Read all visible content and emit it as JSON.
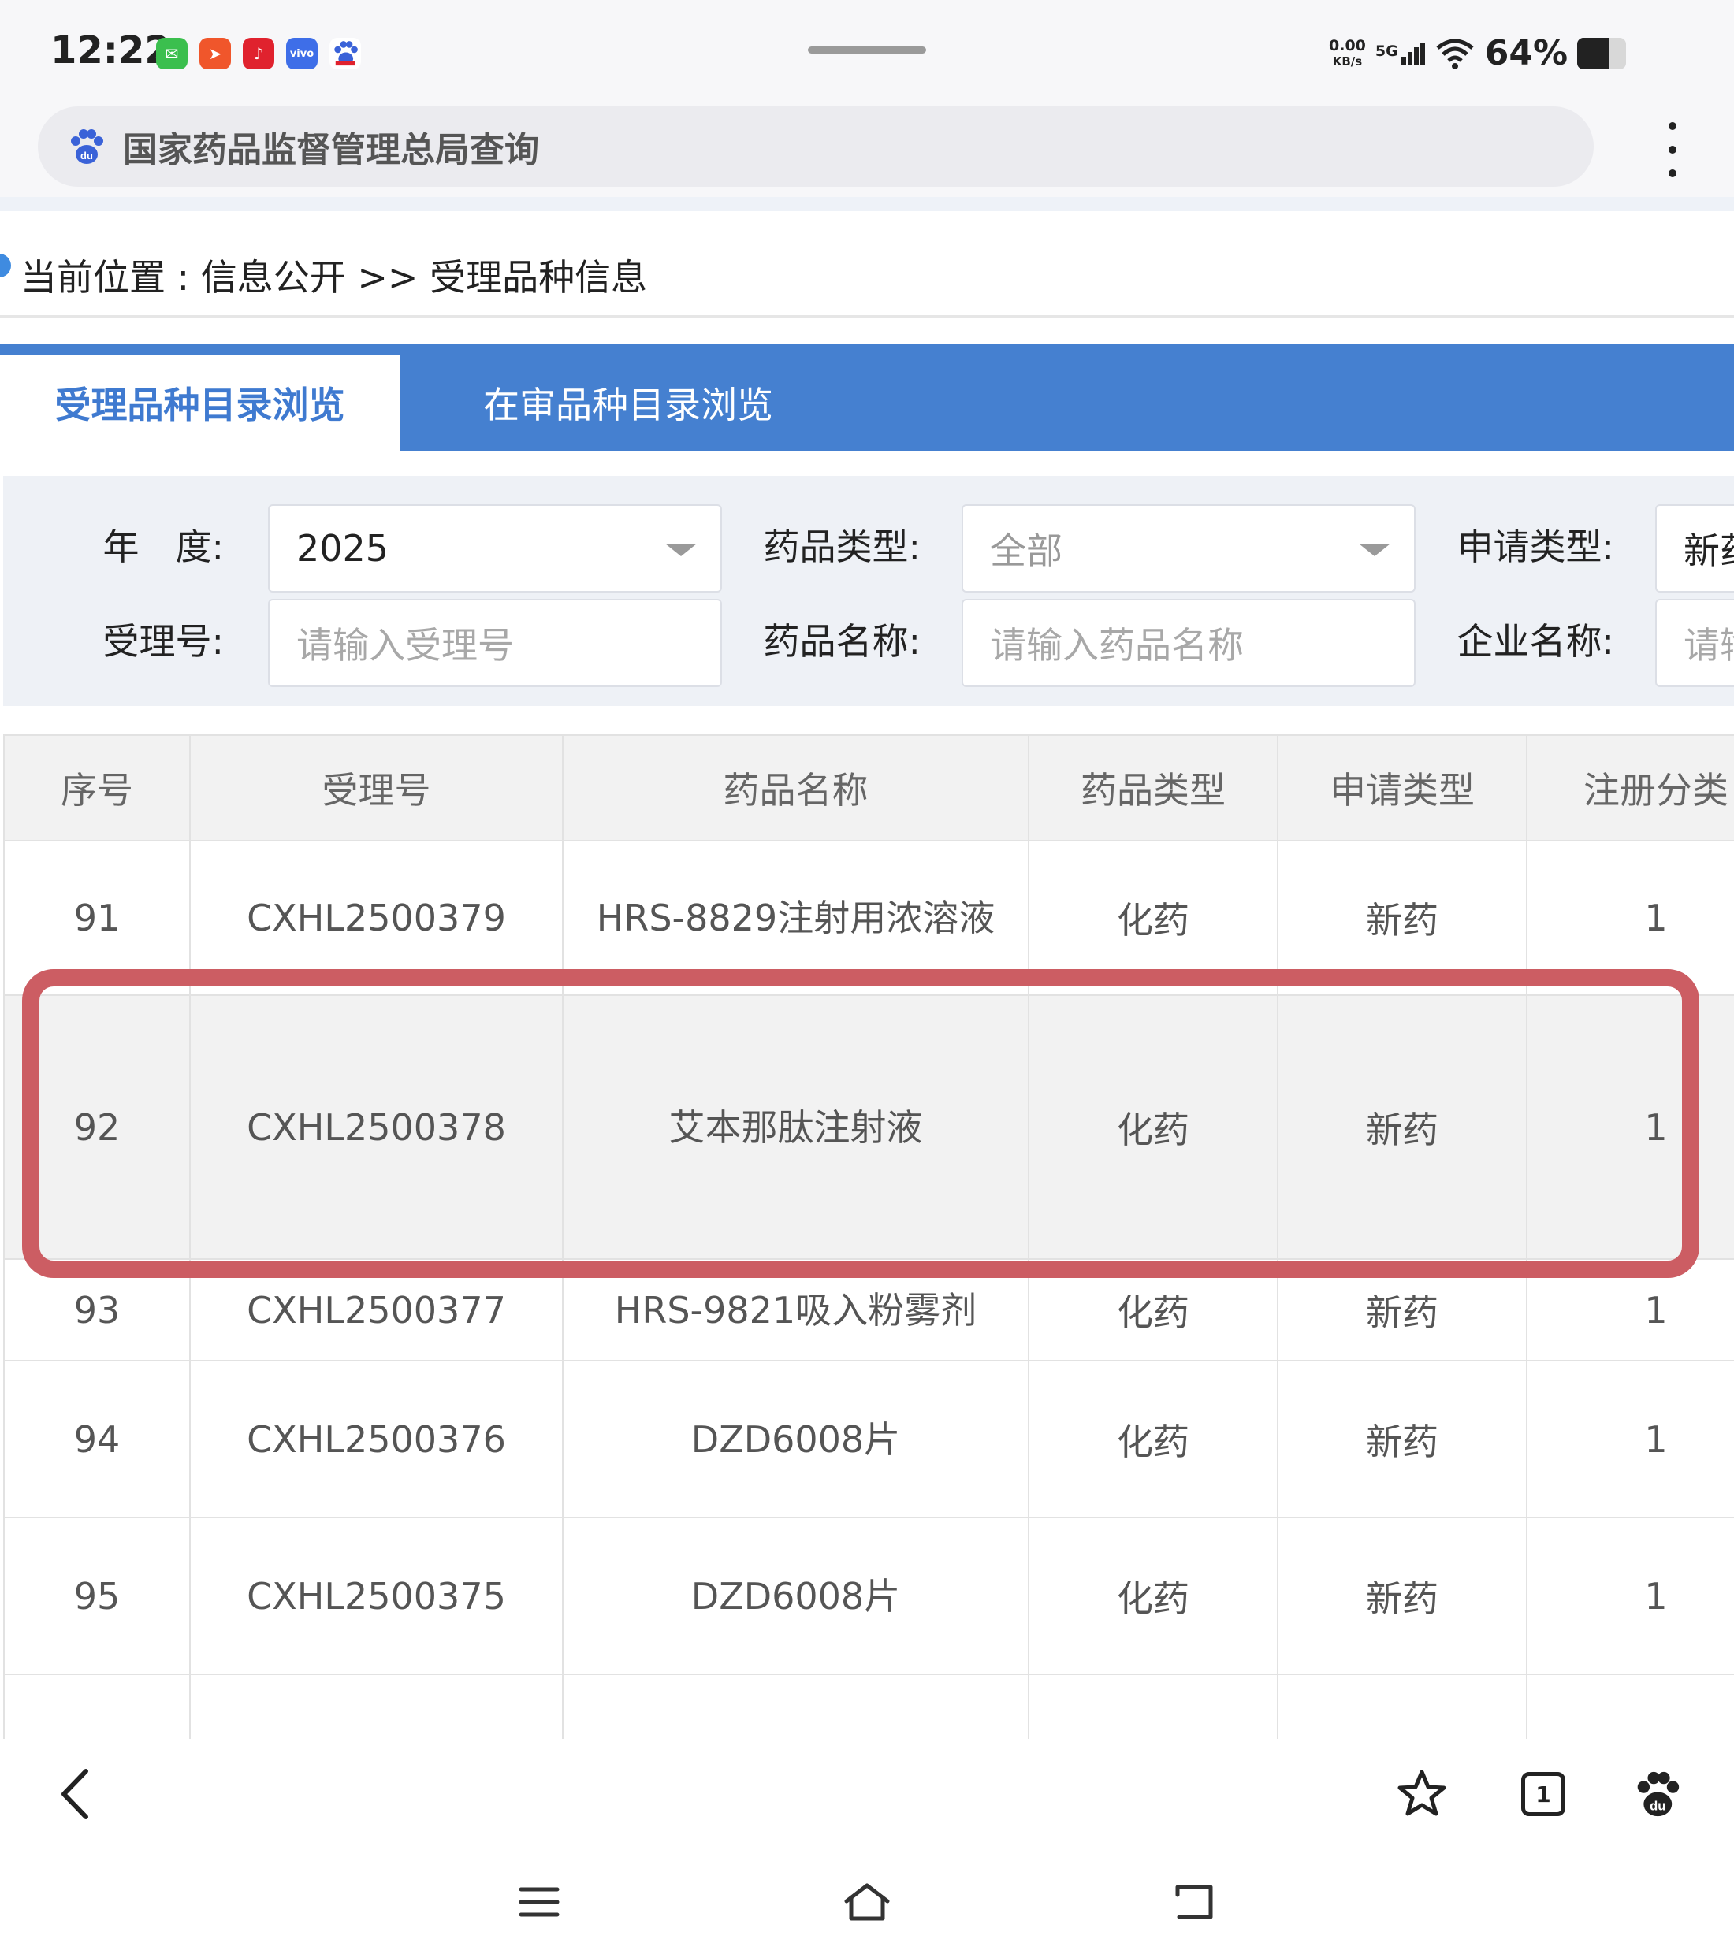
{
  "status_bar": {
    "time": "12:22",
    "net_speed_value": "0.00",
    "net_speed_unit": "KB/s",
    "signal": "5G",
    "battery": "64%",
    "battery_level": 0.64,
    "apps": [
      {
        "icon": "wechat-icon",
        "color": "#3bbf4e"
      },
      {
        "icon": "telegram-like-icon",
        "color": "#f0562b"
      },
      {
        "icon": "netease-music-icon",
        "color": "#e0222e"
      },
      {
        "icon": "vivo-icon",
        "color": "#3e6ee8"
      },
      {
        "icon": "baidu-icon",
        "color": "#ffffff"
      }
    ]
  },
  "browser": {
    "search_text": "国家药品监督管理总局查询",
    "search_icon": "baidu-paw-icon"
  },
  "breadcrumb": {
    "text": "当前位置 : 信息公开 >> 受理品种信息"
  },
  "tabs": [
    {
      "label": "受理品种目录浏览",
      "active": true
    },
    {
      "label": "在审品种目录浏览",
      "active": false
    }
  ],
  "filters": {
    "year_label": "年　度:",
    "year_value": "2025",
    "drug_type_label": "药品类型:",
    "drug_type_value": "全部",
    "apply_type_label": "申请类型:",
    "apply_type_value": "新药",
    "accept_no_label": "受理号:",
    "accept_no_placeholder": "请输入受理号",
    "drug_name_label": "药品名称:",
    "drug_name_placeholder": "请输入药品名称",
    "company_label": "企业名称:",
    "company_placeholder": "请输"
  },
  "table": {
    "headers": [
      "序号",
      "受理号",
      "药品名称",
      "药品类型",
      "申请类型",
      "注册分类"
    ],
    "rows": [
      {
        "no": "91",
        "accept_no": "CXHL2500379",
        "name": "HRS-8829注射用浓溶液",
        "type": "化药",
        "apply": "新药",
        "cls": "1"
      },
      {
        "no": "92",
        "accept_no": "CXHL2500378",
        "name": "艾本那肽注射液",
        "type": "化药",
        "apply": "新药",
        "cls": "1"
      },
      {
        "no": "93",
        "accept_no": "CXHL2500377",
        "name": "HRS-9821吸入粉雾剂",
        "type": "化药",
        "apply": "新药",
        "cls": "1"
      },
      {
        "no": "94",
        "accept_no": "CXHL2500376",
        "name": "DZD6008片",
        "type": "化药",
        "apply": "新药",
        "cls": "1"
      },
      {
        "no": "95",
        "accept_no": "CXHL2500375",
        "name": "DZD6008片",
        "type": "化药",
        "apply": "新药",
        "cls": "1"
      }
    ],
    "highlighted_row": "92"
  },
  "bottom_bar": {
    "tab_count": "1",
    "icons": [
      "back-icon",
      "star-icon",
      "tabs-icon",
      "baidu-paw-icon"
    ]
  },
  "system_nav": {
    "icons": [
      "menu-icon",
      "home-icon",
      "return-icon"
    ]
  },
  "colors": {
    "accent_blue": "#4580d0",
    "active_tab_text": "#3f7ad0",
    "highlight_border": "#cc5d63"
  }
}
